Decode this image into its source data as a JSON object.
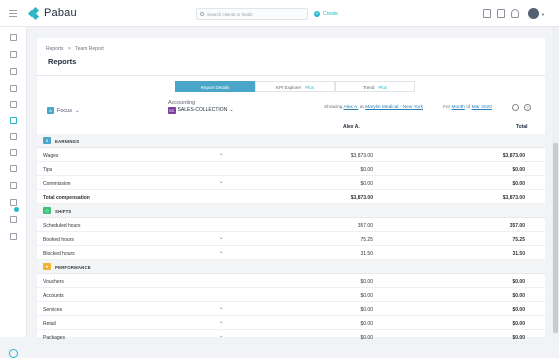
{
  "app": {
    "name": "Pabau"
  },
  "topbar": {
    "search_placeholder": "Search clients or leads",
    "create_label": "Create"
  },
  "breadcrumb": {
    "items": [
      "Reports",
      "Team Report"
    ],
    "separator": ">"
  },
  "page": {
    "title": "Reports"
  },
  "tabs": [
    {
      "label": "Report Details",
      "plus": ""
    },
    {
      "label": "KPI Explorer",
      "plus": "Plus"
    },
    {
      "label": "Trend",
      "plus": "Plus"
    }
  ],
  "filters": {
    "focus_label": "Focus",
    "accounting_label": "Accounting",
    "accounting_badge": "SC",
    "accounting_value": "SALES-COLLECTION",
    "showing_prefix": "Showing",
    "showing_person": "Alex A.",
    "showing_at": "at",
    "showing_location": "Marylin Medical - New York",
    "for_label": "For",
    "for_period": "Month",
    "of_label": "of",
    "for_date": "Mar 2020"
  },
  "columns": {
    "person": "Alex A.",
    "total": "Total"
  },
  "sections": [
    {
      "label": "EARNINGS",
      "color": "#4aa6c8",
      "rows": [
        {
          "label": "Wages",
          "v1": "$3,873.00",
          "v2": "$3,873.00",
          "chev": true
        },
        {
          "label": "Tips",
          "v1": "$0.00",
          "v2": "$0.00",
          "chev": false
        },
        {
          "label": "Commission",
          "v1": "$0.00",
          "v2": "$0.00",
          "chev": true
        },
        {
          "label": "Total compensation",
          "v1": "$3,873.00",
          "v2": "$3,873.00",
          "chev": false,
          "total": true
        }
      ]
    },
    {
      "label": "SHIFTS",
      "color": "#3cbf7a",
      "rows": [
        {
          "label": "Scheduled hours",
          "v1": "357.00",
          "v2": "357.00",
          "chev": false
        },
        {
          "label": "Booked hours",
          "v1": "75.25",
          "v2": "75.25",
          "chev": true
        },
        {
          "label": "Blocked hours",
          "v1": "31.50",
          "v2": "31.50",
          "chev": true
        }
      ]
    },
    {
      "label": "PERFORMANCE",
      "color": "#f2b233",
      "rows": [
        {
          "label": "Vouchers",
          "v1": "$0.00",
          "v2": "$0.00",
          "chev": false
        },
        {
          "label": "Accounts",
          "v1": "$0.00",
          "v2": "$0.00",
          "chev": false
        },
        {
          "label": "Services",
          "v1": "$0.00",
          "v2": "$0.00",
          "chev": true
        },
        {
          "label": "Retail",
          "v1": "$0.00",
          "v2": "$0.00",
          "chev": true
        },
        {
          "label": "Packages",
          "v1": "$0.00",
          "v2": "$0.00",
          "chev": true
        }
      ]
    }
  ]
}
